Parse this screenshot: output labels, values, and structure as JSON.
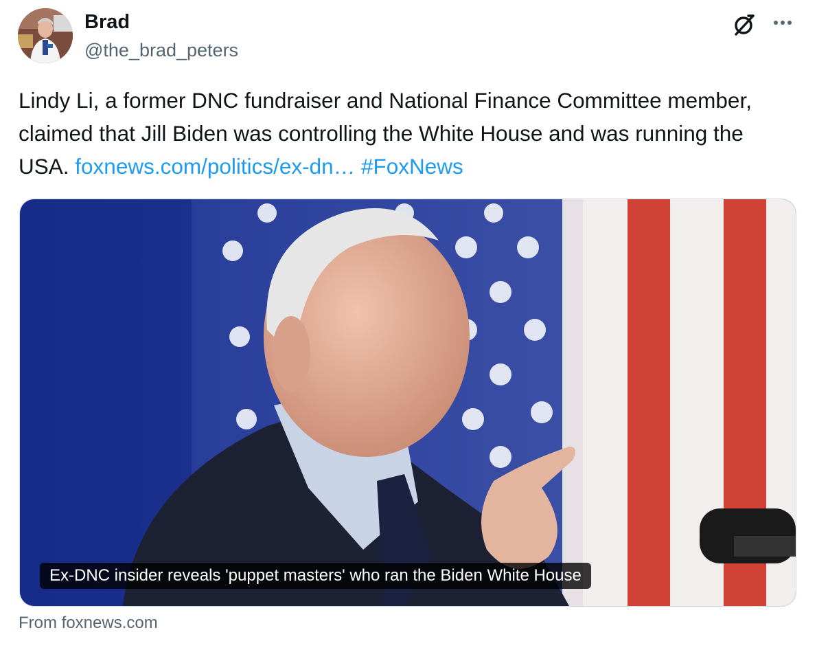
{
  "author": {
    "display_name": "Brad",
    "handle": "@the_brad_peters",
    "avatar_icon": "profile-photo"
  },
  "header_actions": {
    "grok_icon": "grok-icon",
    "more_icon": "more-options-icon"
  },
  "tweet": {
    "text": "Lindy Li, a former DNC fundraiser and National Finance Committee member, claimed that Jill Biden was controlling the White House and was running the USA. ",
    "link": "foxnews.com/politics/ex-dn…",
    "hashtag": "#FoxNews"
  },
  "card": {
    "headline": "Ex-DNC insider reveals 'puppet masters' who ran the Biden White House",
    "source": "From foxnews.com"
  },
  "colors": {
    "link": "#1d9bf0",
    "secondary_text": "#536471",
    "flag_blue": "#2b3f97",
    "flag_red": "#c0392b"
  }
}
